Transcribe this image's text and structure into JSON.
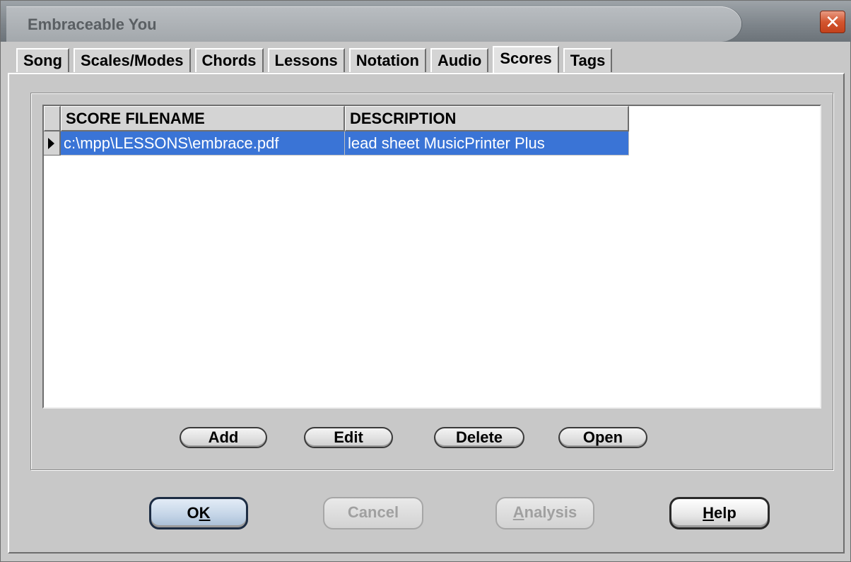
{
  "window": {
    "title": "Embraceable You",
    "close_glyph": "✕"
  },
  "tabs": [
    {
      "label": "Song"
    },
    {
      "label": "Scales/Modes"
    },
    {
      "label": "Chords"
    },
    {
      "label": "Lessons"
    },
    {
      "label": "Notation"
    },
    {
      "label": "Audio"
    },
    {
      "label": "Scores",
      "active": true
    },
    {
      "label": "Tags"
    }
  ],
  "grid": {
    "columns": [
      "SCORE FILENAME",
      "DESCRIPTION"
    ],
    "rows": [
      {
        "filename": "c:\\mpp\\LESSONS\\embrace.pdf",
        "description": "lead sheet MusicPrinter Plus",
        "selected": true
      }
    ]
  },
  "grid_buttons": {
    "add": "Add",
    "edit": "Edit",
    "delete": "Delete",
    "open": "Open"
  },
  "dialog_buttons": {
    "ok_prefix": "O",
    "ok_mnemonic": "K",
    "cancel": "Cancel",
    "analysis_mnemonic": "A",
    "analysis_rest": "nalysis",
    "help_mnemonic": "H",
    "help_rest": "elp"
  },
  "colors": {
    "selection": "#3a74d6",
    "close": "#d3552f",
    "face": "#c8c8c8"
  }
}
